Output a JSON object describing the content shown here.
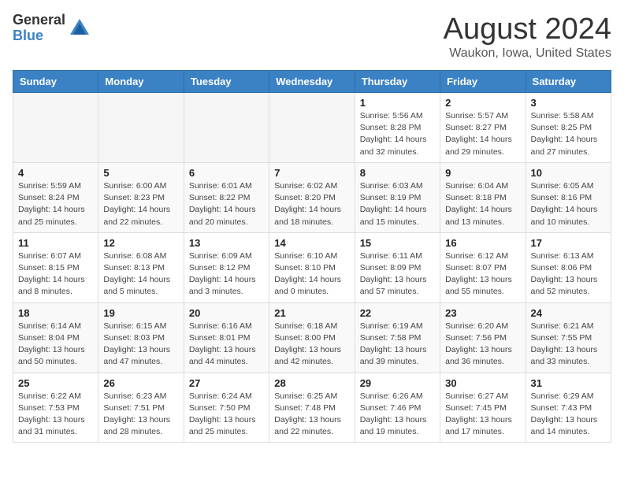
{
  "header": {
    "logo_general": "General",
    "logo_blue": "Blue",
    "month_title": "August 2024",
    "location": "Waukon, Iowa, United States"
  },
  "weekdays": [
    "Sunday",
    "Monday",
    "Tuesday",
    "Wednesday",
    "Thursday",
    "Friday",
    "Saturday"
  ],
  "weeks": [
    [
      {
        "day": "",
        "empty": true
      },
      {
        "day": "",
        "empty": true
      },
      {
        "day": "",
        "empty": true
      },
      {
        "day": "",
        "empty": true
      },
      {
        "day": "1",
        "sunrise": "Sunrise: 5:56 AM",
        "sunset": "Sunset: 8:28 PM",
        "daylight": "Daylight: 14 hours and 32 minutes."
      },
      {
        "day": "2",
        "sunrise": "Sunrise: 5:57 AM",
        "sunset": "Sunset: 8:27 PM",
        "daylight": "Daylight: 14 hours and 29 minutes."
      },
      {
        "day": "3",
        "sunrise": "Sunrise: 5:58 AM",
        "sunset": "Sunset: 8:25 PM",
        "daylight": "Daylight: 14 hours and 27 minutes."
      }
    ],
    [
      {
        "day": "4",
        "sunrise": "Sunrise: 5:59 AM",
        "sunset": "Sunset: 8:24 PM",
        "daylight": "Daylight: 14 hours and 25 minutes."
      },
      {
        "day": "5",
        "sunrise": "Sunrise: 6:00 AM",
        "sunset": "Sunset: 8:23 PM",
        "daylight": "Daylight: 14 hours and 22 minutes."
      },
      {
        "day": "6",
        "sunrise": "Sunrise: 6:01 AM",
        "sunset": "Sunset: 8:22 PM",
        "daylight": "Daylight: 14 hours and 20 minutes."
      },
      {
        "day": "7",
        "sunrise": "Sunrise: 6:02 AM",
        "sunset": "Sunset: 8:20 PM",
        "daylight": "Daylight: 14 hours and 18 minutes."
      },
      {
        "day": "8",
        "sunrise": "Sunrise: 6:03 AM",
        "sunset": "Sunset: 8:19 PM",
        "daylight": "Daylight: 14 hours and 15 minutes."
      },
      {
        "day": "9",
        "sunrise": "Sunrise: 6:04 AM",
        "sunset": "Sunset: 8:18 PM",
        "daylight": "Daylight: 14 hours and 13 minutes."
      },
      {
        "day": "10",
        "sunrise": "Sunrise: 6:05 AM",
        "sunset": "Sunset: 8:16 PM",
        "daylight": "Daylight: 14 hours and 10 minutes."
      }
    ],
    [
      {
        "day": "11",
        "sunrise": "Sunrise: 6:07 AM",
        "sunset": "Sunset: 8:15 PM",
        "daylight": "Daylight: 14 hours and 8 minutes."
      },
      {
        "day": "12",
        "sunrise": "Sunrise: 6:08 AM",
        "sunset": "Sunset: 8:13 PM",
        "daylight": "Daylight: 14 hours and 5 minutes."
      },
      {
        "day": "13",
        "sunrise": "Sunrise: 6:09 AM",
        "sunset": "Sunset: 8:12 PM",
        "daylight": "Daylight: 14 hours and 3 minutes."
      },
      {
        "day": "14",
        "sunrise": "Sunrise: 6:10 AM",
        "sunset": "Sunset: 8:10 PM",
        "daylight": "Daylight: 14 hours and 0 minutes."
      },
      {
        "day": "15",
        "sunrise": "Sunrise: 6:11 AM",
        "sunset": "Sunset: 8:09 PM",
        "daylight": "Daylight: 13 hours and 57 minutes."
      },
      {
        "day": "16",
        "sunrise": "Sunrise: 6:12 AM",
        "sunset": "Sunset: 8:07 PM",
        "daylight": "Daylight: 13 hours and 55 minutes."
      },
      {
        "day": "17",
        "sunrise": "Sunrise: 6:13 AM",
        "sunset": "Sunset: 8:06 PM",
        "daylight": "Daylight: 13 hours and 52 minutes."
      }
    ],
    [
      {
        "day": "18",
        "sunrise": "Sunrise: 6:14 AM",
        "sunset": "Sunset: 8:04 PM",
        "daylight": "Daylight: 13 hours and 50 minutes."
      },
      {
        "day": "19",
        "sunrise": "Sunrise: 6:15 AM",
        "sunset": "Sunset: 8:03 PM",
        "daylight": "Daylight: 13 hours and 47 minutes."
      },
      {
        "day": "20",
        "sunrise": "Sunrise: 6:16 AM",
        "sunset": "Sunset: 8:01 PM",
        "daylight": "Daylight: 13 hours and 44 minutes."
      },
      {
        "day": "21",
        "sunrise": "Sunrise: 6:18 AM",
        "sunset": "Sunset: 8:00 PM",
        "daylight": "Daylight: 13 hours and 42 minutes."
      },
      {
        "day": "22",
        "sunrise": "Sunrise: 6:19 AM",
        "sunset": "Sunset: 7:58 PM",
        "daylight": "Daylight: 13 hours and 39 minutes."
      },
      {
        "day": "23",
        "sunrise": "Sunrise: 6:20 AM",
        "sunset": "Sunset: 7:56 PM",
        "daylight": "Daylight: 13 hours and 36 minutes."
      },
      {
        "day": "24",
        "sunrise": "Sunrise: 6:21 AM",
        "sunset": "Sunset: 7:55 PM",
        "daylight": "Daylight: 13 hours and 33 minutes."
      }
    ],
    [
      {
        "day": "25",
        "sunrise": "Sunrise: 6:22 AM",
        "sunset": "Sunset: 7:53 PM",
        "daylight": "Daylight: 13 hours and 31 minutes."
      },
      {
        "day": "26",
        "sunrise": "Sunrise: 6:23 AM",
        "sunset": "Sunset: 7:51 PM",
        "daylight": "Daylight: 13 hours and 28 minutes."
      },
      {
        "day": "27",
        "sunrise": "Sunrise: 6:24 AM",
        "sunset": "Sunset: 7:50 PM",
        "daylight": "Daylight: 13 hours and 25 minutes."
      },
      {
        "day": "28",
        "sunrise": "Sunrise: 6:25 AM",
        "sunset": "Sunset: 7:48 PM",
        "daylight": "Daylight: 13 hours and 22 minutes."
      },
      {
        "day": "29",
        "sunrise": "Sunrise: 6:26 AM",
        "sunset": "Sunset: 7:46 PM",
        "daylight": "Daylight: 13 hours and 19 minutes."
      },
      {
        "day": "30",
        "sunrise": "Sunrise: 6:27 AM",
        "sunset": "Sunset: 7:45 PM",
        "daylight": "Daylight: 13 hours and 17 minutes."
      },
      {
        "day": "31",
        "sunrise": "Sunrise: 6:29 AM",
        "sunset": "Sunset: 7:43 PM",
        "daylight": "Daylight: 13 hours and 14 minutes."
      }
    ]
  ]
}
